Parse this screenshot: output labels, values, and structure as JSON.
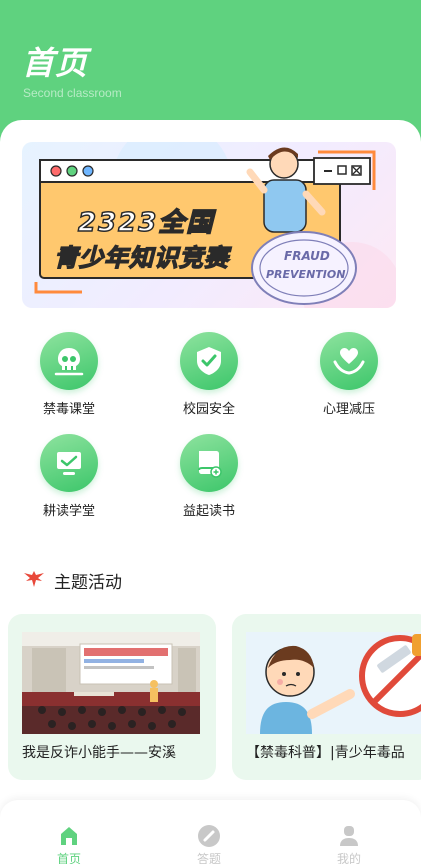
{
  "header": {
    "title": "首页",
    "subtitle": "Second classroom",
    "bg_color": "#5fd27f"
  },
  "banner": {
    "year_prefix": "2323",
    "year_highlight": "全国",
    "line2": "青少年知识竞赛",
    "stamp_text_1": "FRAUD",
    "stamp_text_2": "PREVENTION"
  },
  "grid": {
    "items": [
      {
        "label": "禁毒课堂",
        "icon": "skull-icon"
      },
      {
        "label": "校园安全",
        "icon": "shield-check-icon"
      },
      {
        "label": "心理减压",
        "icon": "heart-hands-icon"
      },
      {
        "label": "耕读学堂",
        "icon": "monitor-book-icon"
      },
      {
        "label": "益起读书",
        "icon": "book-icon"
      }
    ]
  },
  "section": {
    "title": "主题活动",
    "icon": "eagle-icon"
  },
  "cards": [
    {
      "title": "我是反诈小能手——安溪"
    },
    {
      "title": "【禁毒科普】|青少年毒品"
    }
  ],
  "tabs": [
    {
      "label": "首页",
      "icon": "home-icon",
      "active": true
    },
    {
      "label": "答题",
      "icon": "pencil-icon",
      "active": false
    },
    {
      "label": "我的",
      "icon": "user-icon",
      "active": false
    }
  ],
  "colors": {
    "accent": "#5fd27f",
    "tab_inactive": "#c8c8c8",
    "section_icon": "#e8483a"
  }
}
